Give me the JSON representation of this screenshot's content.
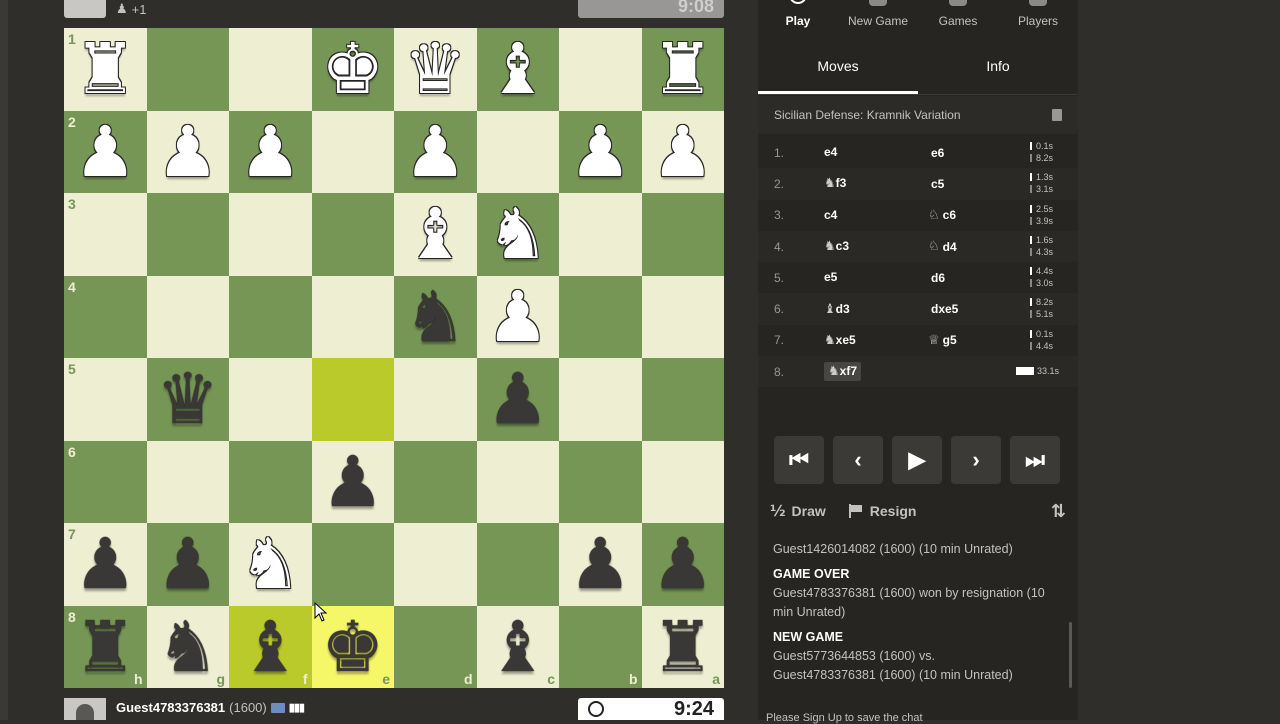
{
  "top_player": {
    "captured_label": "+1",
    "clock": "9:08"
  },
  "board": {
    "rank_labels": [
      "1",
      "2",
      "3",
      "4",
      "5",
      "6",
      "7",
      "8"
    ],
    "file_labels": [
      "h",
      "g",
      "f",
      "e",
      "d",
      "c",
      "b",
      "a"
    ],
    "rows": [
      [
        "wR",
        "",
        "",
        "wK",
        "wQ",
        "wB",
        "",
        "wR"
      ],
      [
        "wP",
        "wP",
        "wP",
        "",
        "wP",
        "",
        "wP",
        "wP"
      ],
      [
        "",
        "",
        "",
        "",
        "wB",
        "wN",
        "",
        ""
      ],
      [
        "",
        "",
        "",
        "",
        "bN",
        "wP",
        "",
        ""
      ],
      [
        "",
        "bQ",
        "",
        "",
        "",
        "bP",
        "",
        ""
      ],
      [
        "",
        "",
        "",
        "bP",
        "",
        "",
        "",
        ""
      ],
      [
        "bP",
        "bP",
        "wN",
        "",
        "",
        "",
        "bP",
        "bP"
      ],
      [
        "bR",
        "bN",
        "bB",
        "bK",
        "",
        "bB",
        "",
        "bR"
      ]
    ],
    "highlighted_squares": [
      "7-2",
      "4-3",
      "7-3"
    ]
  },
  "bottom_player": {
    "name": "Guest4783376381",
    "rating": "(1600)",
    "clock": "9:24"
  },
  "nav": [
    {
      "label": "Play",
      "icon": "play-icon",
      "active": true
    },
    {
      "label": "New Game",
      "icon": "new-game-icon"
    },
    {
      "label": "Games",
      "icon": "games-icon"
    },
    {
      "label": "Players",
      "icon": "players-icon"
    }
  ],
  "tabs": [
    {
      "label": "Moves",
      "active": true
    },
    {
      "label": "Info"
    }
  ],
  "opening": "Sicilian Defense: Kramnik Variation",
  "moves": [
    {
      "num": "1.",
      "w_piece": "",
      "w": "e4",
      "b_piece": "",
      "b": "e6",
      "tw": "0.1s",
      "tb": "8.2s"
    },
    {
      "num": "2.",
      "w_piece": "♞",
      "w": "f3",
      "b_piece": "",
      "b": "c5",
      "tw": "1.3s",
      "tb": "3.1s"
    },
    {
      "num": "3.",
      "w_piece": "",
      "w": "c4",
      "b_piece": "♘",
      "b": "c6",
      "tw": "2.5s",
      "tb": "3.9s"
    },
    {
      "num": "4.",
      "w_piece": "♞",
      "w": "c3",
      "b_piece": "♘",
      "b": "d4",
      "tw": "1.6s",
      "tb": "4.3s"
    },
    {
      "num": "5.",
      "w_piece": "",
      "w": "e5",
      "b_piece": "",
      "b": "d6",
      "tw": "4.4s",
      "tb": "3.0s"
    },
    {
      "num": "6.",
      "w_piece": "♝",
      "w": "d3",
      "b_piece": "",
      "b": "dxe5",
      "tw": "8.2s",
      "tb": "5.1s"
    },
    {
      "num": "7.",
      "w_piece": "♞",
      "w": "xe5",
      "b_piece": "♕",
      "b": "g5",
      "tw": "0.1s",
      "tb": "4.4s"
    },
    {
      "num": "8.",
      "w_piece": "♞",
      "w": "xf7",
      "b_piece": "",
      "b": "",
      "tw": "33.1s",
      "tb": ""
    }
  ],
  "controls": {
    "first": "⏮",
    "prev": "‹",
    "play": "▶",
    "next": "›",
    "last": "⏭"
  },
  "actions": {
    "draw_icon": "½",
    "draw": "Draw",
    "resign": "Resign",
    "flip_icon": "⇅"
  },
  "chat": {
    "line0": "Guest1426014082 (1600) (10 min Unrated)",
    "game_over_head": "GAME OVER",
    "game_over_text": "Guest4783376381 (1600) won by resignation (10 min Unrated)",
    "new_game_head": "NEW GAME",
    "new_game_text1": "Guest5773644853 (1600) vs.",
    "new_game_text2": "Guest4783376381 (1600) (10 min Unrated)",
    "partial": "Please Sign Up to save the chat"
  },
  "colors": {
    "light_square": "#eeeed2",
    "dark_square": "#769656",
    "highlight": "#f6f669"
  }
}
